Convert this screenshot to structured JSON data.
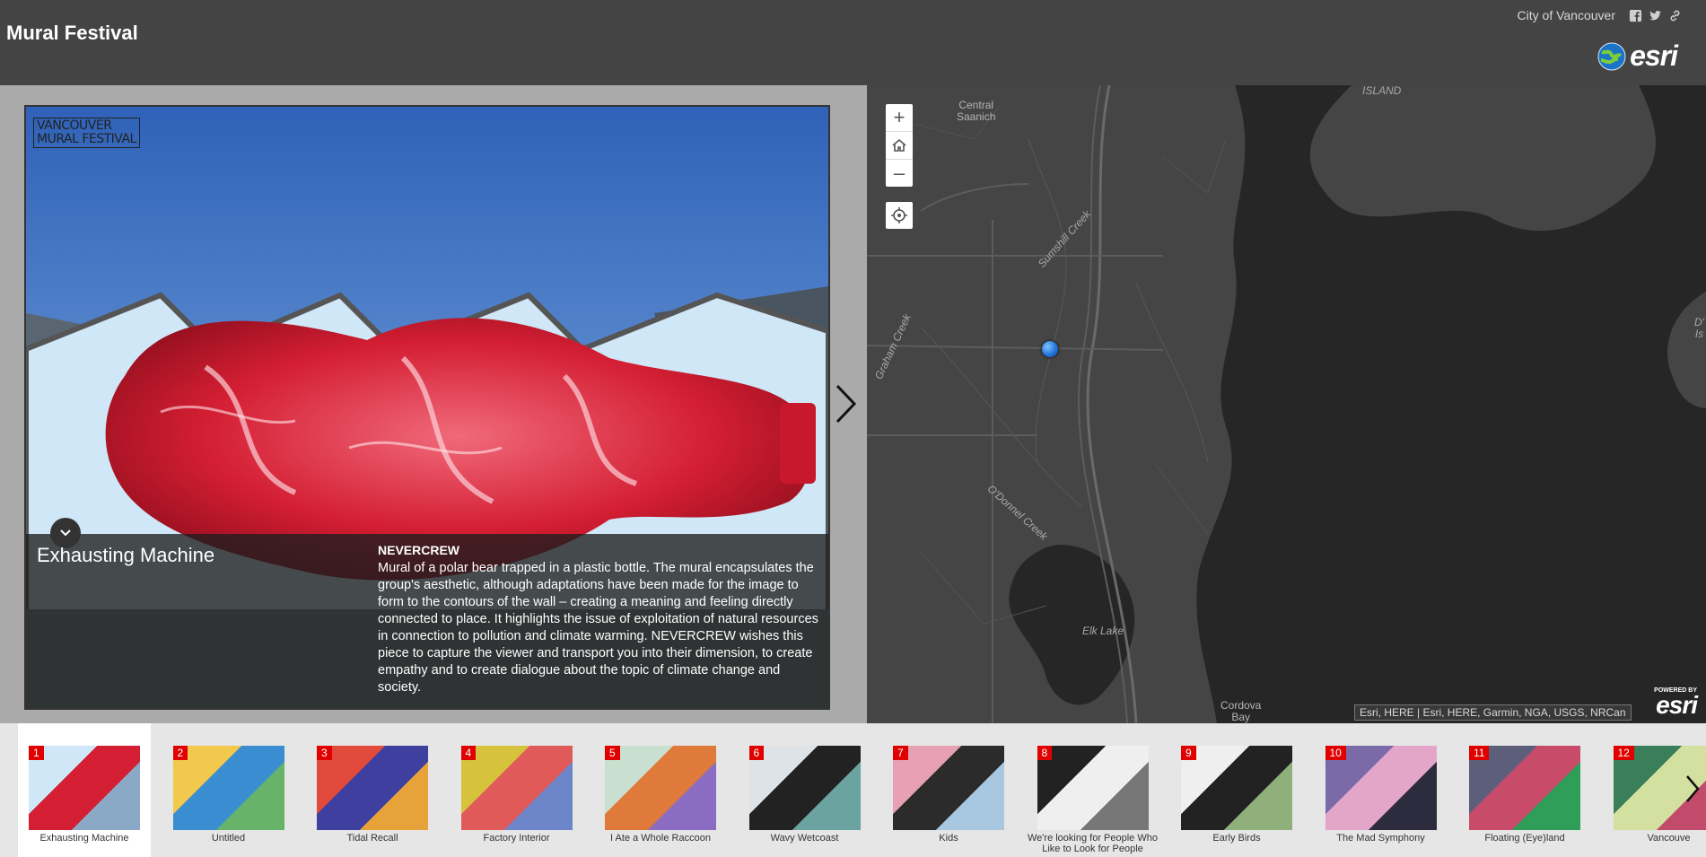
{
  "app": {
    "title": "Mural Festival"
  },
  "header": {
    "org_name": "City of Vancouver",
    "logo_text": "esri"
  },
  "media": {
    "watermark_line1": "VANCOUVER",
    "watermark_line2": "MURAL FESTIVAL",
    "title": "Exhausting Machine",
    "artist": "NEVERCREW",
    "description": "Mural of a polar bear trapped in a plastic bottle. The mural encapsulates the group's aesthetic, although adaptations have been made for the image to form to the contours of the wall – creating a meaning and feeling directly connected to place. It highlights the issue of exploitation of natural resources in connection to pollution and climate warming. NEVERCREW wishes this piece to capture the viewer and transport you into their dimension, to create empathy and to create dialogue about the topic of climate change and society."
  },
  "map": {
    "labels": {
      "central_saanich": "Central\nSaanich",
      "island": "ISLAND",
      "sumshill_creek": "Sumshill Creek",
      "graham_creek": "Graham Creek",
      "odonnel_creek": "O'Donnel Creek",
      "elk_lake": "Elk Lake",
      "cordova_bay": "Cordova\nBay",
      "d_is": "D'\nIs"
    },
    "attribution": "Esri, HERE | Esri, HERE, Garmin, NGA, USGS, NRCan",
    "powered_by": "POWERED BY",
    "powered_logo": "esri"
  },
  "carousel": {
    "items": [
      {
        "num": "1",
        "label": "Exhausting Machine",
        "active": true
      },
      {
        "num": "2",
        "label": "Untitled"
      },
      {
        "num": "3",
        "label": "Tidal Recall"
      },
      {
        "num": "4",
        "label": "Factory Interior"
      },
      {
        "num": "5",
        "label": "I Ate a Whole Raccoon"
      },
      {
        "num": "6",
        "label": "Wavy Wetcoast"
      },
      {
        "num": "7",
        "label": "Kids"
      },
      {
        "num": "8",
        "label": "We're looking for People Who Like to Look for People"
      },
      {
        "num": "9",
        "label": "Early Birds"
      },
      {
        "num": "10",
        "label": "The Mad Symphony"
      },
      {
        "num": "11",
        "label": "Floating (Eye)land"
      },
      {
        "num": "12",
        "label": "Vancouve"
      }
    ]
  },
  "colors": {
    "header_bg": "#444444",
    "accent_red": "#e00000",
    "map_land": "#454545",
    "map_water": "#262626"
  }
}
